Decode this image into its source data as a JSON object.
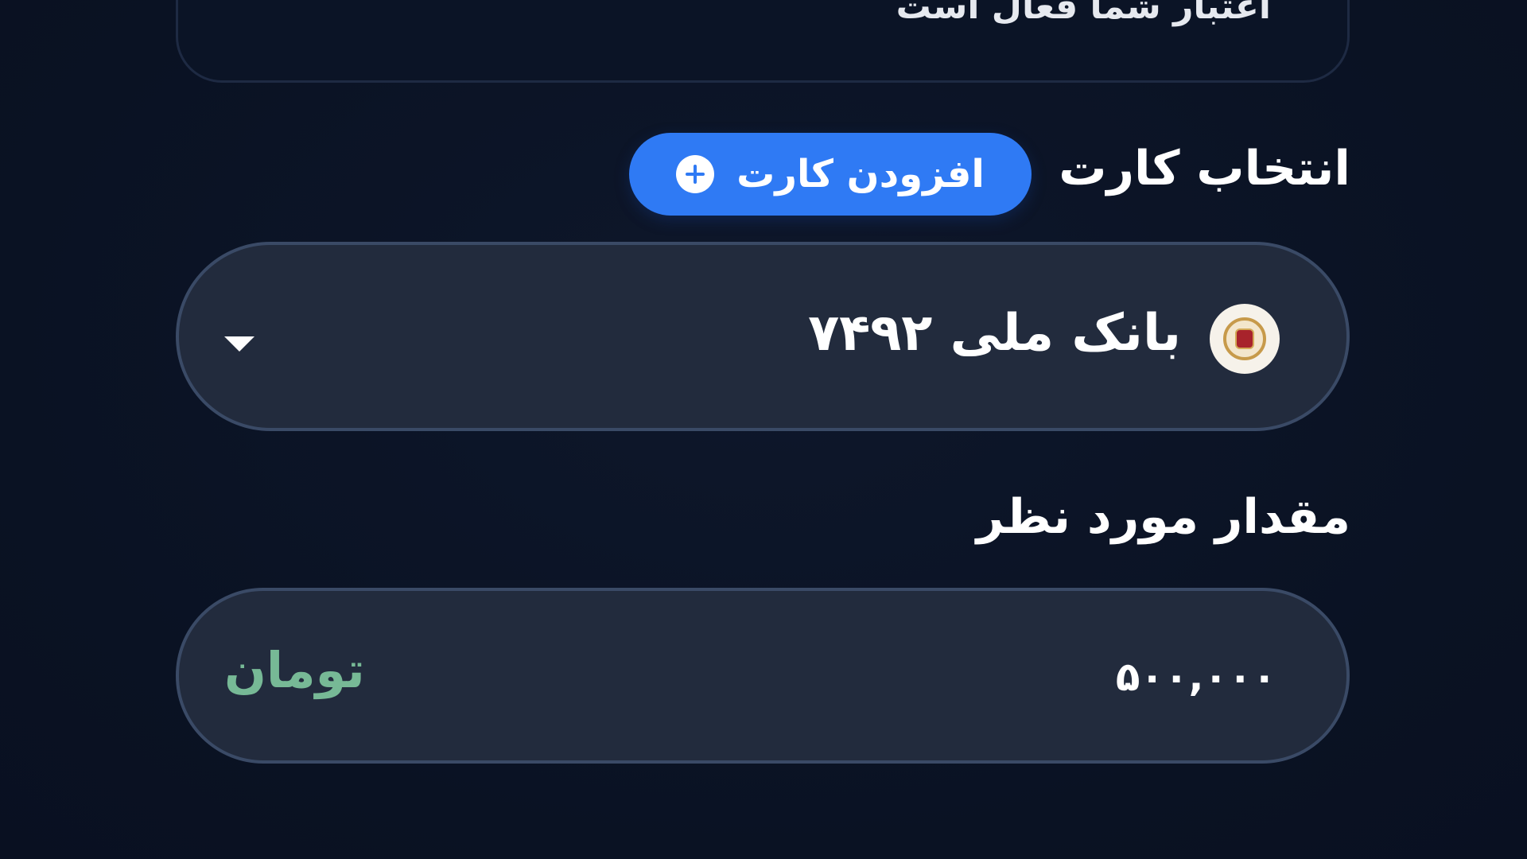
{
  "top_card": {
    "text": "اعتبار شما فعال است"
  },
  "card_section": {
    "title": "انتخاب کارت",
    "add_button_label": "افزودن کارت",
    "selected_card": "بانک ملی ۷۴۹۲",
    "bank_logo": "bank-melli-logo"
  },
  "amount_section": {
    "title": "مقدار مورد نظر",
    "value": "۵۰۰,۰۰۰",
    "currency": "تومان"
  },
  "colors": {
    "background": "#0b1326",
    "field_background": "#222b3d",
    "field_border": "#3a4a66",
    "accent_blue": "#2f7af4",
    "currency_green": "#77b996"
  }
}
